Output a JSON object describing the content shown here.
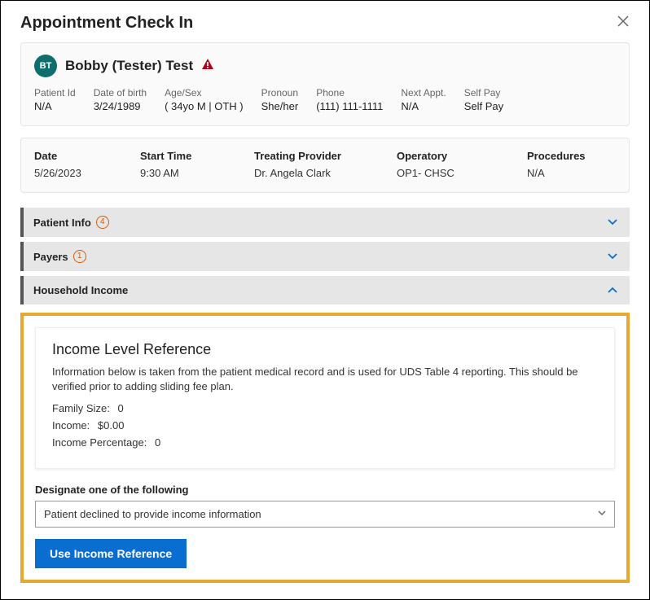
{
  "modal": {
    "title": "Appointment Check In"
  },
  "patient": {
    "avatar": "BT",
    "name": "Bobby (Tester) Test",
    "fields": {
      "patient_id": {
        "label": "Patient Id",
        "value": "N/A"
      },
      "dob": {
        "label": "Date of birth",
        "value": "3/24/1989"
      },
      "age_sex": {
        "label": "Age/Sex",
        "value": "( 34yo M | OTH )"
      },
      "pronoun": {
        "label": "Pronoun",
        "value": "She/her"
      },
      "phone": {
        "label": "Phone",
        "value": "(111) 111-1111"
      },
      "next_appt": {
        "label": "Next Appt.",
        "value": "N/A"
      },
      "self_pay": {
        "label": "Self Pay",
        "value": "Self Pay"
      }
    }
  },
  "appointment": {
    "date": {
      "label": "Date",
      "value": "5/26/2023"
    },
    "start_time": {
      "label": "Start Time",
      "value": "9:30 AM"
    },
    "provider": {
      "label": "Treating Provider",
      "value": "Dr. Angela Clark"
    },
    "operatory": {
      "label": "Operatory",
      "value": "OP1- CHSC"
    },
    "procedures": {
      "label": "Procedures",
      "value": "N/A"
    }
  },
  "accordions": {
    "patient_info": {
      "title": "Patient Info",
      "badge": "4"
    },
    "payers": {
      "title": "Payers",
      "badge": "1"
    },
    "household": {
      "title": "Household Income"
    }
  },
  "income_ref": {
    "title": "Income Level Reference",
    "desc": "Information below is taken from the patient medical record and is used for UDS Table 4 reporting. This should be verified prior to adding sliding fee plan.",
    "family_size": {
      "label": "Family Size",
      "value": "0"
    },
    "income": {
      "label": "Income",
      "value": "$0.00"
    },
    "income_pct": {
      "label": "Income Percentage",
      "value": "0"
    }
  },
  "designate": {
    "label": "Designate one of the following",
    "selected": "Patient declined to provide income information"
  },
  "button": {
    "use_income_ref": "Use Income Reference"
  }
}
